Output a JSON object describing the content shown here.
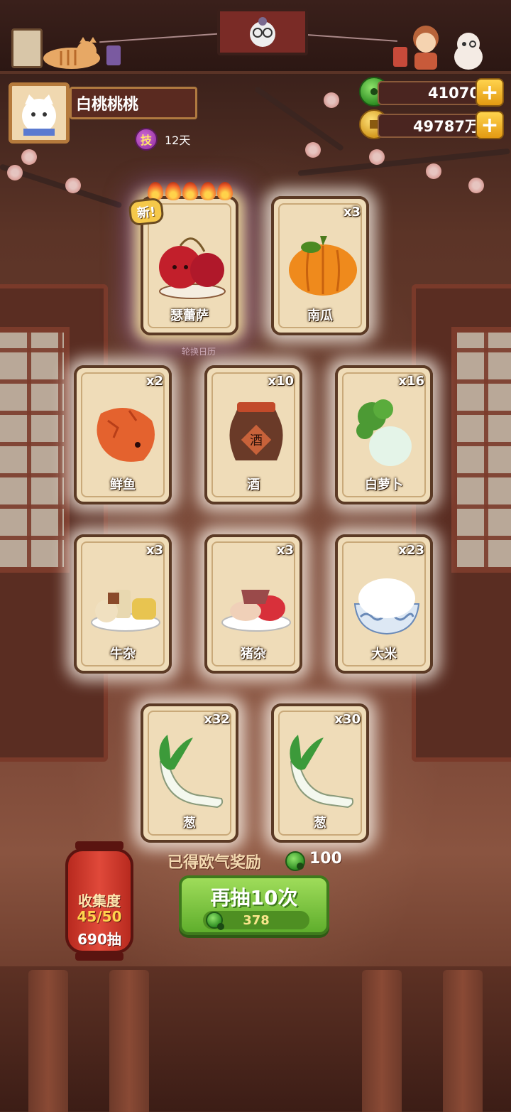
{
  "player": {
    "name": "白桃桃桃",
    "skill_icon_text": "技",
    "days": "12天"
  },
  "currency": [
    {
      "icon": "jade-icon",
      "value": "41070"
    },
    {
      "icon": "coin-icon",
      "value": "49787万"
    }
  ],
  "calendar_label": "轮换日历",
  "cards": [
    {
      "name": "瑟蕾萨",
      "count": "",
      "is_new": true,
      "new_label": "新!",
      "art": "cherry"
    },
    {
      "name": "南瓜",
      "count": "x3",
      "art": "pumpkin"
    },
    {
      "name": "鲜鱼",
      "count": "x2",
      "art": "fish"
    },
    {
      "name": "酒",
      "count": "x10",
      "art": "wine",
      "art_text": "酒"
    },
    {
      "name": "白萝卜",
      "count": "x16",
      "art": "radish"
    },
    {
      "name": "牛杂",
      "count": "x3",
      "art": "beef"
    },
    {
      "name": "猪杂",
      "count": "x3",
      "art": "pork"
    },
    {
      "name": "大米",
      "count": "x23",
      "art": "rice"
    },
    {
      "name": "葱",
      "count": "x32",
      "art": "scallion"
    },
    {
      "name": "葱",
      "count": "x30",
      "art": "scallion"
    }
  ],
  "reward": {
    "label": "已得欧气奖励",
    "value": "100"
  },
  "draw_button": {
    "label": "再抽10次",
    "cost": "378"
  },
  "collection": {
    "title": "收集度",
    "progress": "45/50",
    "draws": "690抽"
  },
  "colors": {
    "accent_green": "#5fae2c",
    "lantern_red": "#d43a2c",
    "card_bg": "#efdcb8"
  }
}
